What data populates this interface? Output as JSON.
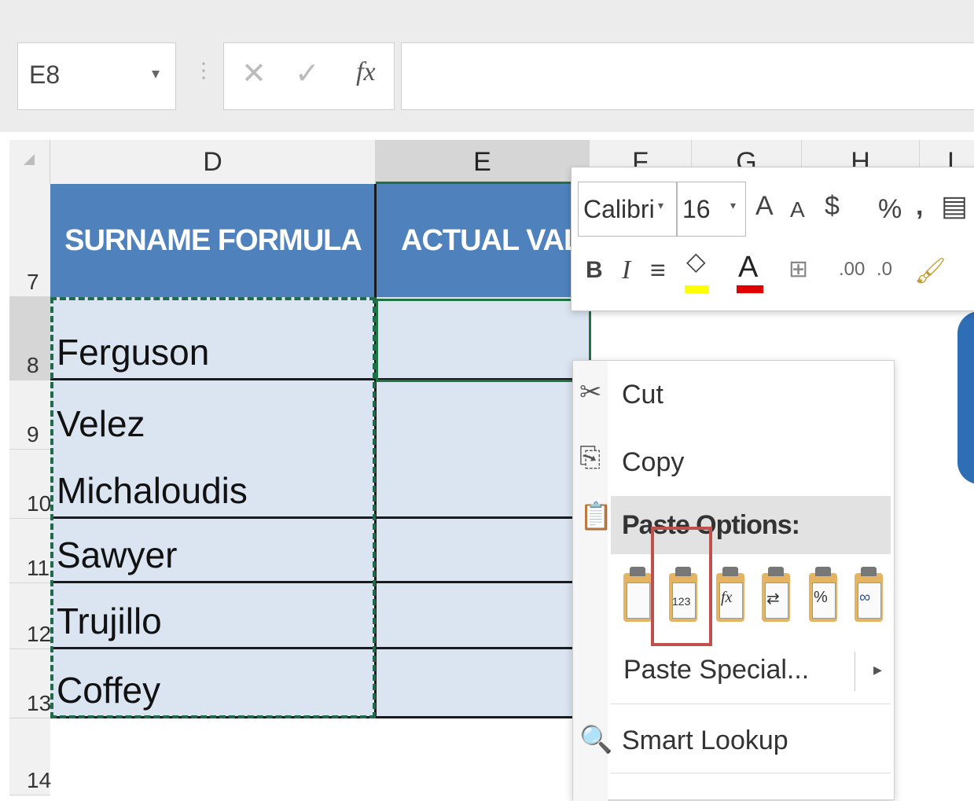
{
  "formula_bar": {
    "name_box": "E8",
    "name_box_arrow": "▾",
    "separator": "⋮",
    "cancel": "✕",
    "enter": "✓",
    "fx": "fx",
    "formula": ""
  },
  "columns": [
    "D",
    "E",
    "F",
    "G",
    "H",
    "I"
  ],
  "rows": [
    "7",
    "8",
    "9",
    "10",
    "11",
    "12",
    "13",
    "14"
  ],
  "table": {
    "header_d": "SURNAME FORMULA",
    "header_e": "ACTUAL VALUE",
    "surnames": [
      "Ferguson",
      "Velez",
      "Michaloudis",
      "Sawyer",
      "Trujillo",
      "Coffey"
    ]
  },
  "mini_toolbar": {
    "font_name": "Calibri",
    "font_size": "16",
    "dropdown": "▾",
    "increase_font": "A",
    "decrease_font": "A",
    "currency": "$",
    "percent": "%",
    "comma": ",",
    "format_table": "▤",
    "bold": "B",
    "italic": "I",
    "align": "≡",
    "fill": "◇",
    "font_color": "A",
    "borders": "⊞",
    "increase_decimal": ".00",
    "decrease_decimal": ".0",
    "format_painter": "🖌",
    "fill_color": "#ffff00",
    "font_color_value": "#e00000"
  },
  "context_menu": {
    "cut": "Cut",
    "copy": "Copy",
    "paste_options": "Paste Options:",
    "paste_glyphs": [
      "",
      "123",
      "fx",
      "⇄",
      "%",
      "∞"
    ],
    "paste_special": "Paste Special...",
    "paste_special_arrow": "▸",
    "smart_lookup": "Smart Lookup"
  },
  "colors": {
    "header_blue": "#4f81bd",
    "cell_fill": "#dbe5f1",
    "selection_green": "#217346",
    "highlight_red": "#c0504d"
  }
}
